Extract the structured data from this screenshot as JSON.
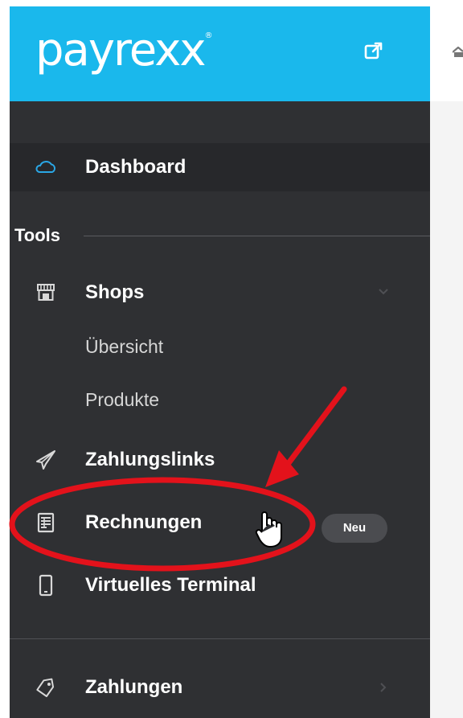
{
  "brand": {
    "logo_text": "payrexx",
    "logo_mark": "®",
    "external_link_icon": "external-link-icon"
  },
  "sidebar": {
    "dashboard": {
      "label": "Dashboard",
      "icon": "cloud-icon"
    },
    "section_title": "Tools",
    "shops": {
      "label": "Shops",
      "icon": "storefront-icon",
      "expanded": true,
      "subitems": [
        "Übersicht",
        "Produkte"
      ]
    },
    "zahlungslinks": {
      "label": "Zahlungslinks",
      "icon": "paper-plane-icon"
    },
    "rechnungen": {
      "label": "Rechnungen",
      "icon": "invoice-icon",
      "badge": "Neu"
    },
    "terminal": {
      "label": "Virtuelles Terminal",
      "icon": "tablet-icon"
    },
    "zahlungen": {
      "label": "Zahlungen",
      "icon": "tag-icon"
    }
  },
  "colors": {
    "brand_blue": "#1ab8ec",
    "sidebar_bg": "#2f3033",
    "active_bg": "#27282b",
    "annotation_red": "#e3121b"
  }
}
